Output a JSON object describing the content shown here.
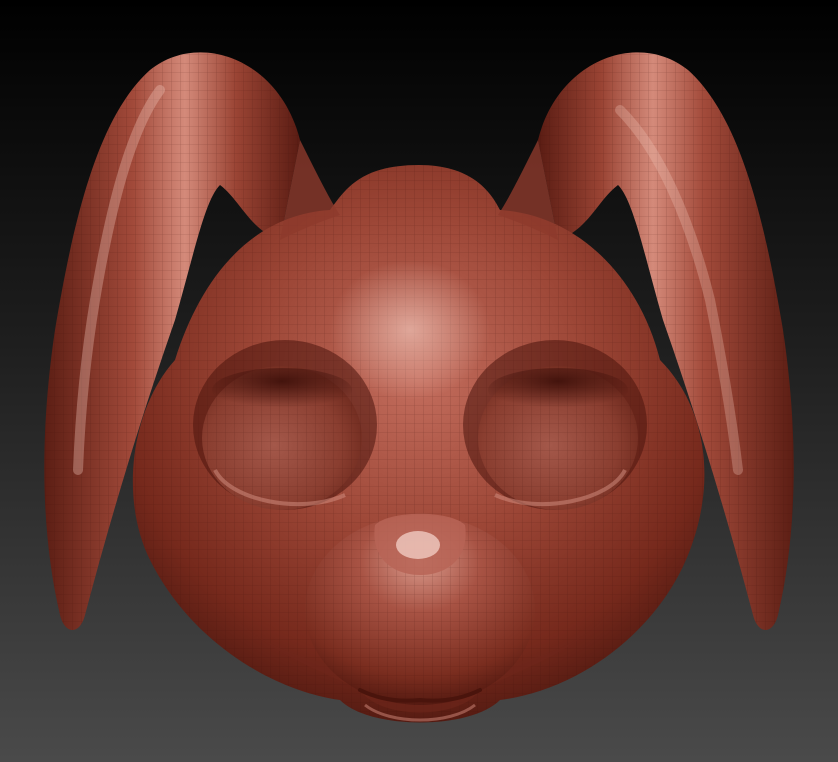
{
  "scene": {
    "subject": "rabbit-head-sculpt-model",
    "material": "clay-red",
    "mesh_wireframe_visible": true,
    "colors": {
      "background_top": "#000000",
      "background_bottom": "#4a4a4a",
      "clay_base": "#8e3a2c",
      "clay_shadow": "#5a1f16",
      "clay_highlight": "#d89080",
      "clay_specular": "#f4d2c8"
    }
  }
}
